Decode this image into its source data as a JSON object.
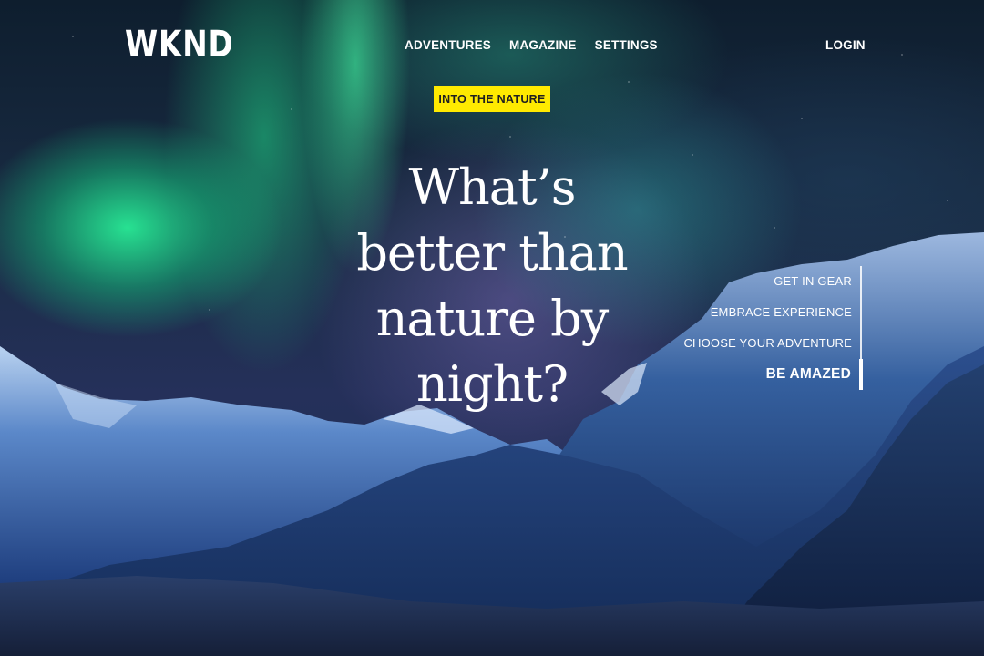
{
  "header": {
    "logo": "WKND",
    "nav": [
      {
        "label": "ADVENTURES"
      },
      {
        "label": "MAGAZINE"
      },
      {
        "label": "SETTINGS"
      }
    ],
    "login_label": "LOGIN"
  },
  "hero": {
    "badge": "INTO THE NATURE",
    "headline": "What’s better than nature by night?"
  },
  "carousel": {
    "items": [
      {
        "label": "GET IN GEAR",
        "active": false
      },
      {
        "label": "EMBRACE EXPERIENCE",
        "active": false
      },
      {
        "label": "CHOOSE YOUR ADVENTURE",
        "active": false
      },
      {
        "label": "BE AMAZED",
        "active": true
      }
    ]
  },
  "colors": {
    "badge_bg": "#ffea00",
    "text": "#ffffff"
  }
}
